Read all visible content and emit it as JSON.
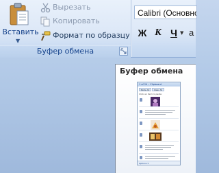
{
  "ribbon": {
    "clipboard_group": {
      "paste": {
        "label": "Вставить",
        "icon": "paste-icon"
      },
      "cut": {
        "label": "Вырезать",
        "icon": "scissors-icon",
        "enabled": false
      },
      "copy": {
        "label": "Копировать",
        "icon": "copy-icon",
        "enabled": false
      },
      "format_painter": {
        "label": "Формат по образцу",
        "icon": "format-painter-icon",
        "enabled": true
      },
      "caption": "Буфер обмена",
      "launcher_icon": "dialog-launcher-icon"
    },
    "font_group": {
      "font_name": "Calibri (Основно",
      "bold": "Ж",
      "italic": "К",
      "underline": "Ч",
      "extra": "a"
    }
  },
  "tooltip": {
    "title": "Буфер обмена",
    "preview": {
      "header": "1 of 24 – Clipboard",
      "buttons": [
        "Paste All",
        "Clear All"
      ],
      "hint": "Click an item to paste:",
      "footer": "Options ▾"
    }
  },
  "colors": {
    "ribbon_text": "#15428b",
    "ribbon_bg": "#dde8f7",
    "window_bg": "#b4cbe8"
  }
}
